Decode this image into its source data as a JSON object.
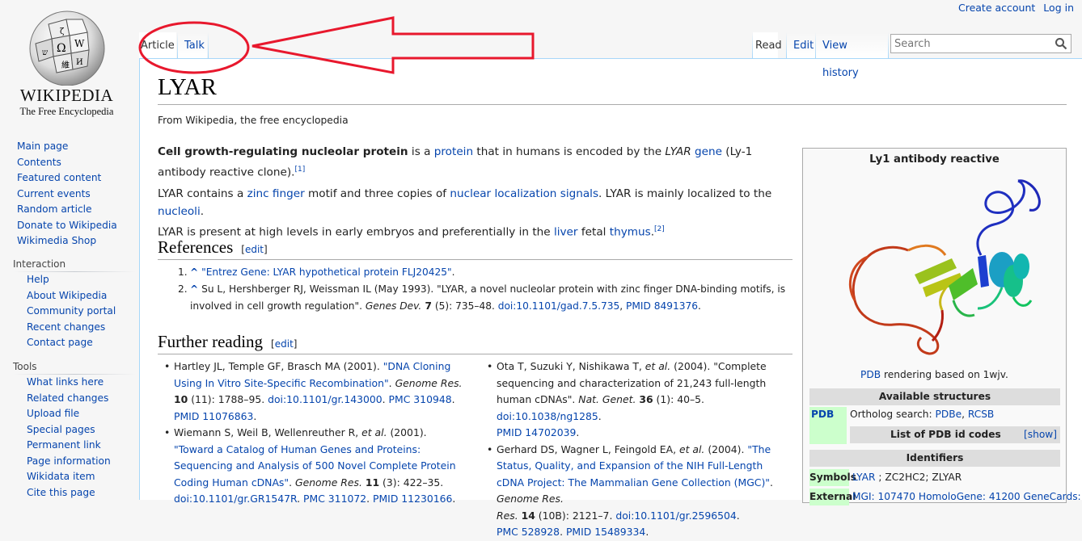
{
  "personal": {
    "create_account": "Create account",
    "login": "Log in"
  },
  "logo": {
    "wordmark": "WIKIPEDIA",
    "tagline": "The Free Encyclopedia"
  },
  "sidebar": {
    "main_links": [
      "Main page",
      "Contents",
      "Featured content",
      "Current events",
      "Random article",
      "Donate to Wikipedia",
      "Wikimedia Shop"
    ],
    "interaction_heading": "Interaction",
    "interaction_links": [
      "Help",
      "About Wikipedia",
      "Community portal",
      "Recent changes",
      "Contact page"
    ],
    "tools_heading": "Tools",
    "tools_links": [
      "What links here",
      "Related changes",
      "Upload file",
      "Special pages",
      "Permanent link",
      "Page information",
      "Wikidata item",
      "Cite this page"
    ]
  },
  "tabs": {
    "article": "Article",
    "talk": "Talk",
    "read": "Read",
    "edit": "Edit",
    "history": "View history"
  },
  "search": {
    "placeholder": "Search"
  },
  "article": {
    "title": "LYAR",
    "tagline": "From Wikipedia, the free encyclopedia",
    "p1": {
      "bold": "Cell growth-regulating nucleolar protein",
      "t1": " is a ",
      "l1": "protein",
      "t2": " that in humans is encoded by the ",
      "i1": "LYAR",
      "t3": " ",
      "l2": "gene",
      "t4": " (Ly-1 antibody reactive clone).",
      "ref": "[1]"
    },
    "p2": {
      "t1": "LYAR contains a ",
      "l1": "zinc finger",
      "t2": " motif and three copies of ",
      "l2": "nuclear localization signals",
      "t3": ". LYAR is mainly localized to the ",
      "l3": "nucleoli",
      "t4": ".",
      "t5": "LYAR is present at high levels in early embryos and preferentially in the ",
      "l4": "liver",
      "t6": " fetal ",
      "l5": "thymus",
      "t7": ".",
      "ref": "[2]"
    },
    "references_heading": "References",
    "edit_label": "[edit]",
    "ref1": {
      "num": "1.",
      "caret": "^",
      "link": "\"Entrez Gene: LYAR hypothetical protein FLJ20425\"",
      "end": "."
    },
    "ref2": {
      "num": "2.",
      "caret": "^",
      "line1": "Su L, Hershberger RJ, Weissman IL (May 1993). \"LYAR, a novel nucleolar protein with zinc finger DNA-binding motifs, is",
      "line2a": "involved in cell growth regulation\". ",
      "journal": "Genes Dev.",
      "vol": " 7",
      "line2b": " (5): 735–48. ",
      "doi": "doi:10.1101/gad.7.5.735",
      "pmid": "PMID 8491376",
      "end": "."
    },
    "further_heading": "Further reading",
    "further_left": [
      {
        "a": "Hartley JL, Temple GF, Brasch MA (2001). ",
        "link": "\"DNA Cloning Using In Vitro Site-Specific Recombination\"",
        "b": ". ",
        "journal": "Genome Res.",
        "vol": "10",
        "c": " (11): 1788–95. ",
        "doi": "doi:10.1101/gr.143000",
        "pmc": "PMC 310948",
        "pmid": "PMID 11076863"
      },
      {
        "a": "Wiemann S, Weil B, Wellenreuther R, ",
        "etal": "et al.",
        "a2": " (2001). ",
        "link": "\"Toward a Catalog of Human Genes and Proteins: Sequencing and Analysis of 500 Novel Complete Protein Coding Human cDNAs\"",
        "b": ". ",
        "journal": "Genome Res.",
        "vol": "11",
        "c": " (3): 422–35.",
        "doi": "doi:10.1101/gr.GR1547R",
        "pmc": "PMC 311072",
        "pmid": "PMID 11230166"
      }
    ],
    "further_right": [
      {
        "a": "Ota T, Suzuki Y, Nishikawa T, ",
        "etal": "et al.",
        "a2": " (2004). \"Complete sequencing and characterization of 21,243 full-length human cDNAs\". ",
        "journal": "Nat. Genet.",
        "vol": "36",
        "c": " (1): 40–5. ",
        "doi": "doi:10.1038/ng1285",
        "pmid": "PMID 14702039"
      },
      {
        "a": "Gerhard DS, Wagner L, Feingold EA, ",
        "etal": "et al.",
        "a2": " (2004). ",
        "link": "\"The Status, Quality, and Expansion of the NIH Full-Length cDNA Project: The Mammalian Gene Collection (MGC)\"",
        "b": ". ",
        "journal": "Genome Res.",
        "vol": "14",
        "c": " (10B): 2121–7. ",
        "doi": "doi:10.1101/gr.2596504",
        "pmc": "PMC 528928",
        "pmid": "PMID 15489334"
      }
    ]
  },
  "infobox": {
    "title": "Ly1 antibody reactive",
    "caption_link": "PDB",
    "caption_text": " rendering based on 1wjv.",
    "available": "Available structures",
    "pdb_label": "PDB",
    "ortholog": "Ortholog search: ",
    "pdbe": "PDBe",
    "rcsb": "RCSB",
    "pdb_list": "List of PDB id codes",
    "show": "[show]",
    "identifiers": "Identifiers",
    "symbols_label": "Symbols",
    "symbols_link": "LYAR",
    "symbols_rest": " ; ZC2HC2; ZLYAR",
    "external_label": "External",
    "external_text": "MGI: 107470 HomoloGene: 41200 GeneCards:"
  },
  "colors": {
    "link": "#0645ad",
    "annotation": "#e8182d"
  }
}
